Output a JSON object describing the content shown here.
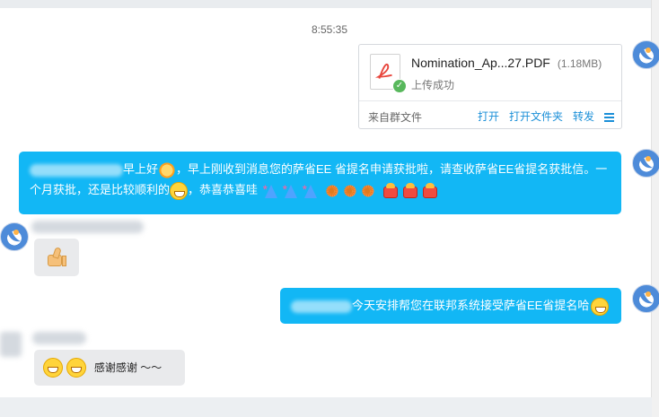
{
  "timestamp": "8:55:35",
  "file_card": {
    "file_name": "Nomination_Ap...27.PDF",
    "file_size": "(1.18MB)",
    "status": "上传成功",
    "source": "来自群文件",
    "actions": {
      "open": "打开",
      "open_folder": "打开文件夹",
      "forward": "转发"
    },
    "icon": "pdf-icon",
    "status_icon": "check-icon"
  },
  "messages": {
    "m1_part1": "早上好",
    "m1_part2": "，早上刚收到消息您的萨省EE 省提名申请获批啦，请查收萨省EE省提名获批信。一",
    "m1_part3": "个月获批，还是比较顺利的",
    "m1_part4": "，恭喜恭喜哇",
    "m3_text": "今天安排帮您在联邦系统接受萨省EE省提名哈",
    "m4_text": "感谢感谢 ～～"
  },
  "colors": {
    "bubble_blue": "#12b7f5",
    "bubble_gray": "#e9eaec",
    "link_blue": "#1a8fd8",
    "success_green": "#58b85c"
  }
}
